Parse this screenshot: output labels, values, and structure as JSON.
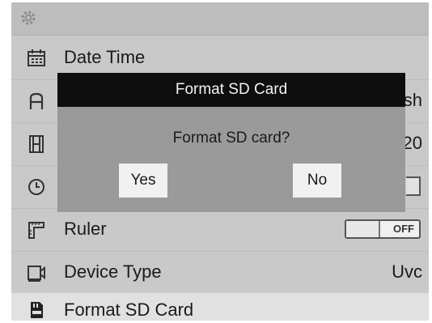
{
  "menu": {
    "items": [
      {
        "label": "Date Time",
        "value": "",
        "icon": "calendar-icon"
      },
      {
        "label": "",
        "value": "ish",
        "icon": "font-icon"
      },
      {
        "label": "",
        "value": "20",
        "icon": "film-icon"
      },
      {
        "label": "",
        "value": "",
        "icon": "clock-icon"
      },
      {
        "label": "Ruler",
        "value": "",
        "icon": "ruler-icon",
        "toggle": "OFF"
      },
      {
        "label": "Device Type",
        "value": "Uvc",
        "icon": "camera-icon"
      },
      {
        "label": "Format SD Card",
        "value": "",
        "icon": "sd-card-icon"
      }
    ]
  },
  "dialog": {
    "title": "Format SD Card",
    "message": "Format SD card?",
    "yes_label": "Yes",
    "no_label": "No"
  }
}
